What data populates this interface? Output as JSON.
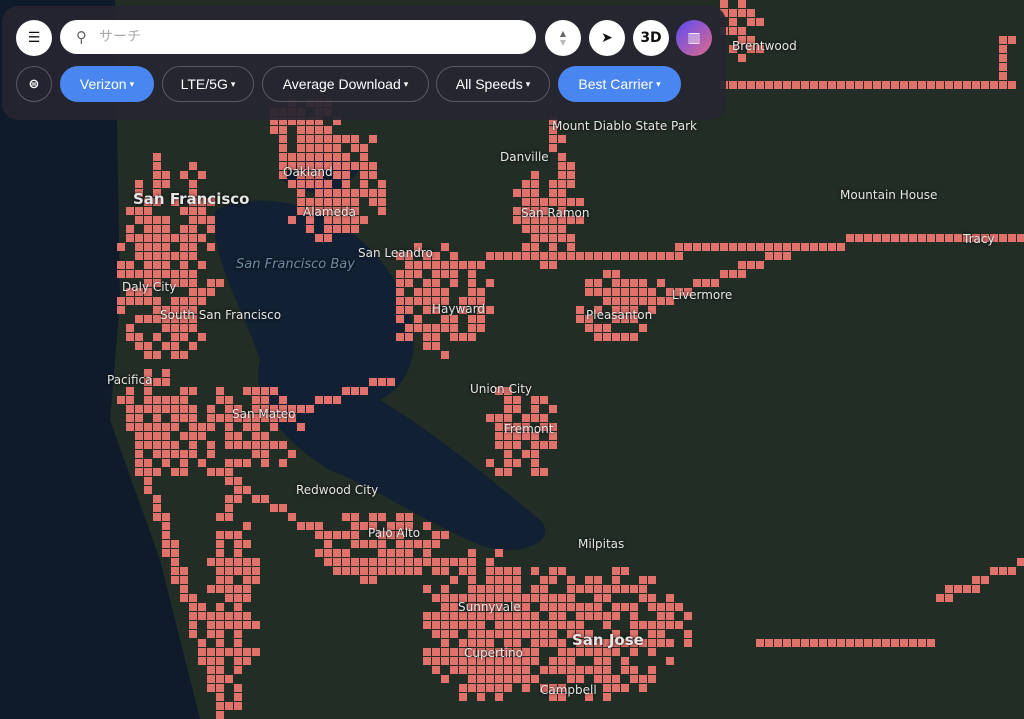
{
  "search": {
    "placeholder": "サーチ"
  },
  "buttons": {
    "three_d": "3D"
  },
  "filters": [
    {
      "label": "Verizon",
      "active": true
    },
    {
      "label": "LTE/5G",
      "active": false
    },
    {
      "label": "Average Download",
      "active": false
    },
    {
      "label": "All Speeds",
      "active": false
    },
    {
      "label": "Best Carrier",
      "active": true
    }
  ],
  "map": {
    "coverage_color": "#e0716b",
    "labels": {
      "sf": "San Francisco",
      "oakland": "Oakland",
      "alameda": "Alameda",
      "sanleandro": "San Leandro",
      "daly": "Daly City",
      "ssf": "South San Francisco",
      "pacifica": "Pacifica",
      "sanmateo": "San Mateo",
      "redwood": "Redwood City",
      "paloalto": "Palo Alto",
      "hayward": "Hayward",
      "union": "Union City",
      "fremont": "Fremont",
      "milpitas": "Milpitas",
      "sunnyvale": "Sunnyvale",
      "sanjose": "San Jose",
      "cupertino": "Cupertino",
      "campbell": "Campbell",
      "danville": "Danville",
      "sanramon": "San Ramon",
      "pleasanton": "Pleasanton",
      "livermore": "Livermore",
      "diablo": "Mount Diablo State Park",
      "mtnhouse": "Mountain House",
      "tracy": "Tracy",
      "brentwood": "Brentwood",
      "bay": "San Francisco Bay"
    }
  }
}
